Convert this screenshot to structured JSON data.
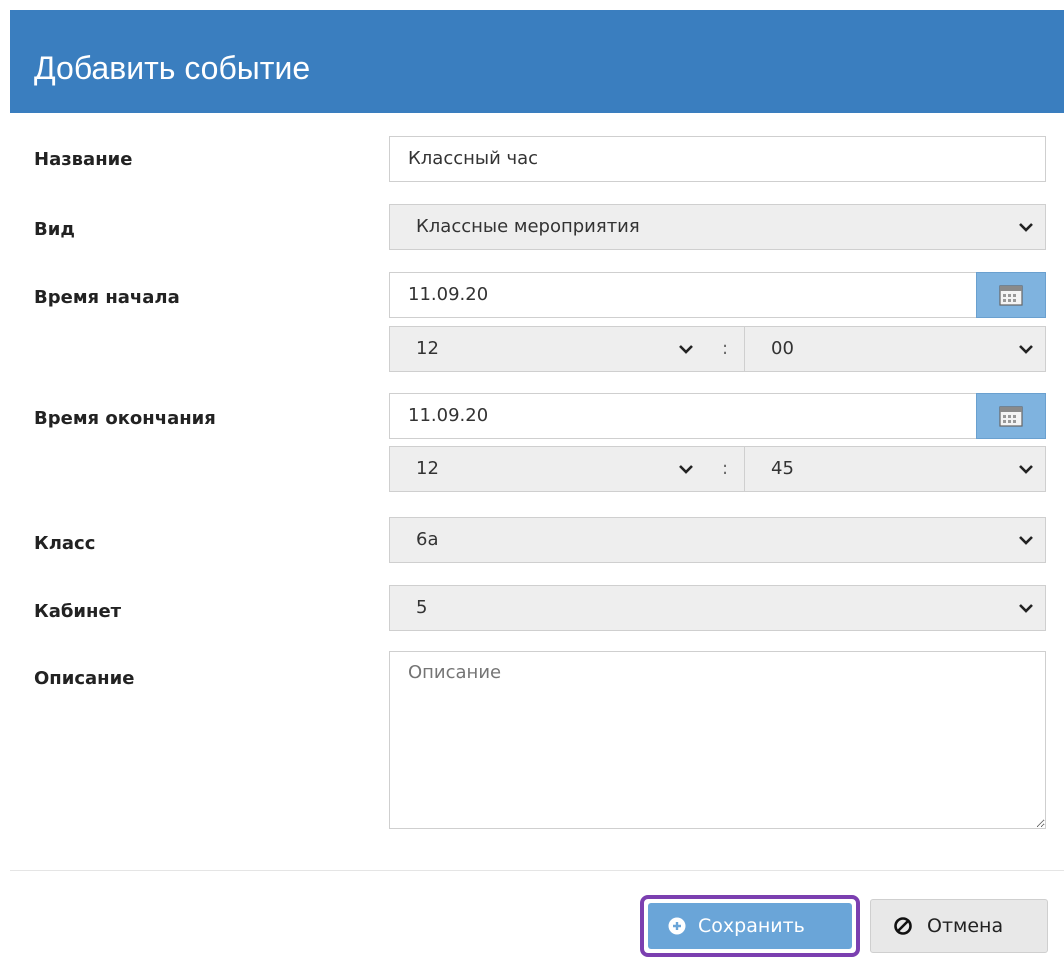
{
  "dialog": {
    "title": "Добавить событие"
  },
  "form": {
    "name": {
      "label": "Название",
      "value": "Классный час"
    },
    "type": {
      "label": "Вид",
      "value": "Классные мероприятия"
    },
    "start": {
      "label": "Время начала",
      "date": "11.09.20",
      "hour": "12",
      "minute": "00",
      "separator": ":"
    },
    "end": {
      "label": "Время окончания",
      "date": "11.09.20",
      "hour": "12",
      "minute": "45",
      "separator": ":"
    },
    "class": {
      "label": "Класс",
      "value": "6а"
    },
    "room": {
      "label": "Кабинет",
      "value": "5"
    },
    "description": {
      "label": "Описание",
      "placeholder": "Описание"
    }
  },
  "buttons": {
    "save": {
      "label": "Сохранить",
      "icon": "plus-circle-icon"
    },
    "cancel": {
      "label": "Отмена",
      "icon": "ban-icon"
    }
  },
  "colors": {
    "header": "#3a7ebf",
    "save": "#6aa5d8",
    "highlight": "#7b3fb0"
  }
}
